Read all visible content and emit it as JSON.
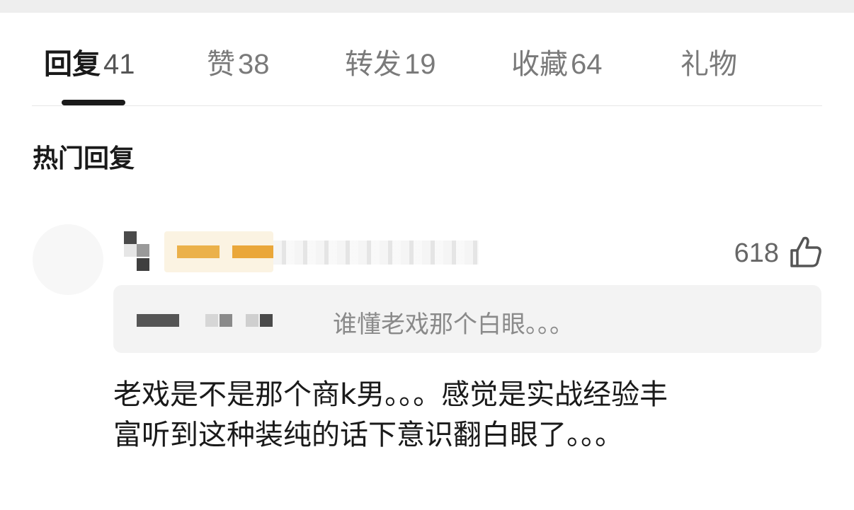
{
  "tabs": [
    {
      "label": "回复",
      "count": "41"
    },
    {
      "label": "赞",
      "count": "38"
    },
    {
      "label": "转发",
      "count": "19"
    },
    {
      "label": "收藏",
      "count": "64"
    },
    {
      "label": "礼物",
      "count": ""
    }
  ],
  "active_tab": "回复",
  "section_title": "热门回复",
  "comment": {
    "like_count": "618",
    "quote_text": "谁懂老戏那个白眼。。。",
    "body_line1": "老戏是不是那个商k男。。。感觉是实战经验丰",
    "body_line2": "富听到这种装纯的话下意识翻白眼了。。。"
  },
  "icons": {
    "like": "thumbs-up-icon"
  }
}
